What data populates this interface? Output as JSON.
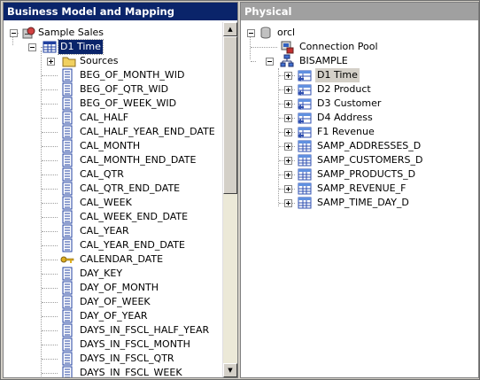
{
  "left_pane": {
    "title": "Business Model and Mapping",
    "root": "Sample Sales",
    "selected": "D1 Time",
    "folder": "Sources",
    "columns": [
      "BEG_OF_MONTH_WID",
      "BEG_OF_QTR_WID",
      "BEG_OF_WEEK_WID",
      "CAL_HALF",
      "CAL_HALF_YEAR_END_DATE",
      "CAL_MONTH",
      "CAL_MONTH_END_DATE",
      "CAL_QTR",
      "CAL_QTR_END_DATE",
      "CAL_WEEK",
      "CAL_WEEK_END_DATE",
      "CAL_YEAR",
      "CAL_YEAR_END_DATE",
      "CALENDAR_DATE",
      "DAY_KEY",
      "DAY_OF_MONTH",
      "DAY_OF_WEEK",
      "DAY_OF_YEAR",
      "DAYS_IN_FSCL_HALF_YEAR",
      "DAYS_IN_FSCL_MONTH",
      "DAYS_IN_FSCL_QTR",
      "DAYS_IN_FSCL_WEEK"
    ],
    "key_column": "CALENDAR_DATE"
  },
  "right_pane": {
    "title": "Physical",
    "database": "orcl",
    "connection_pool": "Connection Pool",
    "schema": "BISAMPLE",
    "aliases": [
      "D1 Time",
      "D2 Product",
      "D3 Customer",
      "D4 Address",
      "F1 Revenue"
    ],
    "tables": [
      "SAMP_ADDRESSES_D",
      "SAMP_CUSTOMERS_D",
      "SAMP_PRODUCTS_D",
      "SAMP_REVENUE_F",
      "SAMP_TIME_DAY_D"
    ],
    "highlighted": "D1 Time"
  },
  "colors": {
    "active_title": "#0a246a",
    "inactive_title": "#a0a0a0",
    "frame": "#d4d0c8"
  }
}
